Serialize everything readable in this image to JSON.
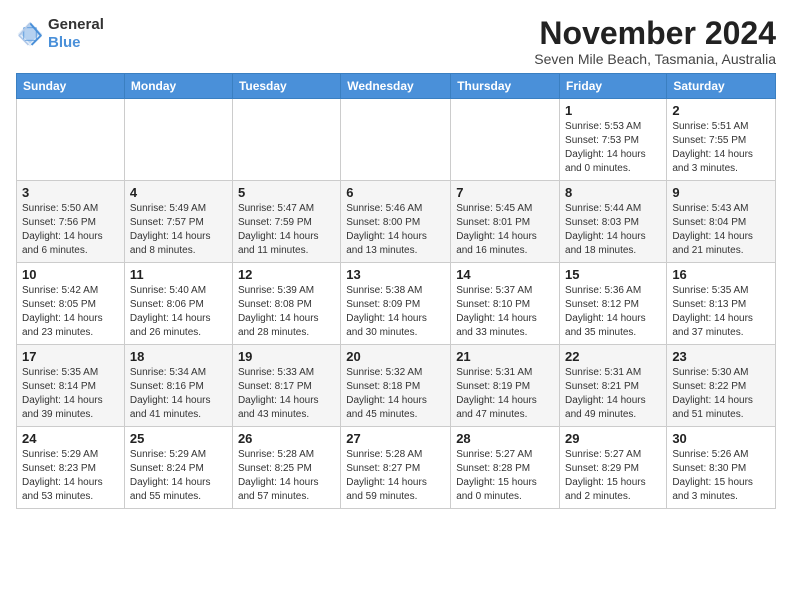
{
  "header": {
    "logo_general": "General",
    "logo_blue": "Blue",
    "month_title": "November 2024",
    "subtitle": "Seven Mile Beach, Tasmania, Australia"
  },
  "days_of_week": [
    "Sunday",
    "Monday",
    "Tuesday",
    "Wednesday",
    "Thursday",
    "Friday",
    "Saturday"
  ],
  "weeks": [
    [
      {
        "day": "",
        "info": ""
      },
      {
        "day": "",
        "info": ""
      },
      {
        "day": "",
        "info": ""
      },
      {
        "day": "",
        "info": ""
      },
      {
        "day": "",
        "info": ""
      },
      {
        "day": "1",
        "info": "Sunrise: 5:53 AM\nSunset: 7:53 PM\nDaylight: 14 hours and 0 minutes."
      },
      {
        "day": "2",
        "info": "Sunrise: 5:51 AM\nSunset: 7:55 PM\nDaylight: 14 hours and 3 minutes."
      }
    ],
    [
      {
        "day": "3",
        "info": "Sunrise: 5:50 AM\nSunset: 7:56 PM\nDaylight: 14 hours and 6 minutes."
      },
      {
        "day": "4",
        "info": "Sunrise: 5:49 AM\nSunset: 7:57 PM\nDaylight: 14 hours and 8 minutes."
      },
      {
        "day": "5",
        "info": "Sunrise: 5:47 AM\nSunset: 7:59 PM\nDaylight: 14 hours and 11 minutes."
      },
      {
        "day": "6",
        "info": "Sunrise: 5:46 AM\nSunset: 8:00 PM\nDaylight: 14 hours and 13 minutes."
      },
      {
        "day": "7",
        "info": "Sunrise: 5:45 AM\nSunset: 8:01 PM\nDaylight: 14 hours and 16 minutes."
      },
      {
        "day": "8",
        "info": "Sunrise: 5:44 AM\nSunset: 8:03 PM\nDaylight: 14 hours and 18 minutes."
      },
      {
        "day": "9",
        "info": "Sunrise: 5:43 AM\nSunset: 8:04 PM\nDaylight: 14 hours and 21 minutes."
      }
    ],
    [
      {
        "day": "10",
        "info": "Sunrise: 5:42 AM\nSunset: 8:05 PM\nDaylight: 14 hours and 23 minutes."
      },
      {
        "day": "11",
        "info": "Sunrise: 5:40 AM\nSunset: 8:06 PM\nDaylight: 14 hours and 26 minutes."
      },
      {
        "day": "12",
        "info": "Sunrise: 5:39 AM\nSunset: 8:08 PM\nDaylight: 14 hours and 28 minutes."
      },
      {
        "day": "13",
        "info": "Sunrise: 5:38 AM\nSunset: 8:09 PM\nDaylight: 14 hours and 30 minutes."
      },
      {
        "day": "14",
        "info": "Sunrise: 5:37 AM\nSunset: 8:10 PM\nDaylight: 14 hours and 33 minutes."
      },
      {
        "day": "15",
        "info": "Sunrise: 5:36 AM\nSunset: 8:12 PM\nDaylight: 14 hours and 35 minutes."
      },
      {
        "day": "16",
        "info": "Sunrise: 5:35 AM\nSunset: 8:13 PM\nDaylight: 14 hours and 37 minutes."
      }
    ],
    [
      {
        "day": "17",
        "info": "Sunrise: 5:35 AM\nSunset: 8:14 PM\nDaylight: 14 hours and 39 minutes."
      },
      {
        "day": "18",
        "info": "Sunrise: 5:34 AM\nSunset: 8:16 PM\nDaylight: 14 hours and 41 minutes."
      },
      {
        "day": "19",
        "info": "Sunrise: 5:33 AM\nSunset: 8:17 PM\nDaylight: 14 hours and 43 minutes."
      },
      {
        "day": "20",
        "info": "Sunrise: 5:32 AM\nSunset: 8:18 PM\nDaylight: 14 hours and 45 minutes."
      },
      {
        "day": "21",
        "info": "Sunrise: 5:31 AM\nSunset: 8:19 PM\nDaylight: 14 hours and 47 minutes."
      },
      {
        "day": "22",
        "info": "Sunrise: 5:31 AM\nSunset: 8:21 PM\nDaylight: 14 hours and 49 minutes."
      },
      {
        "day": "23",
        "info": "Sunrise: 5:30 AM\nSunset: 8:22 PM\nDaylight: 14 hours and 51 minutes."
      }
    ],
    [
      {
        "day": "24",
        "info": "Sunrise: 5:29 AM\nSunset: 8:23 PM\nDaylight: 14 hours and 53 minutes."
      },
      {
        "day": "25",
        "info": "Sunrise: 5:29 AM\nSunset: 8:24 PM\nDaylight: 14 hours and 55 minutes."
      },
      {
        "day": "26",
        "info": "Sunrise: 5:28 AM\nSunset: 8:25 PM\nDaylight: 14 hours and 57 minutes."
      },
      {
        "day": "27",
        "info": "Sunrise: 5:28 AM\nSunset: 8:27 PM\nDaylight: 14 hours and 59 minutes."
      },
      {
        "day": "28",
        "info": "Sunrise: 5:27 AM\nSunset: 8:28 PM\nDaylight: 15 hours and 0 minutes."
      },
      {
        "day": "29",
        "info": "Sunrise: 5:27 AM\nSunset: 8:29 PM\nDaylight: 15 hours and 2 minutes."
      },
      {
        "day": "30",
        "info": "Sunrise: 5:26 AM\nSunset: 8:30 PM\nDaylight: 15 hours and 3 minutes."
      }
    ]
  ]
}
